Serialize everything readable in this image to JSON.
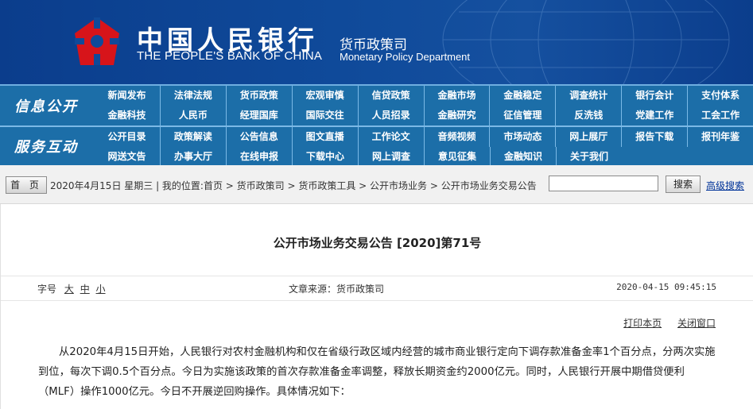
{
  "header": {
    "brand_cn": "中国人民银行",
    "brand_en": "THE PEOPLE'S BANK OF CHINA",
    "dept_cn": "货币政策司",
    "dept_en": "Monetary Policy Department"
  },
  "nav": {
    "info_title": "信息公开",
    "service_title": "服务互动",
    "info_row1": [
      "新闻发布",
      "法律法规",
      "货币政策",
      "宏观审慎",
      "信贷政策",
      "金融市场",
      "金融稳定",
      "调查统计",
      "银行会计",
      "支付体系"
    ],
    "info_row2": [
      "金融科技",
      "人民币",
      "经理国库",
      "国际交往",
      "人员招录",
      "金融研究",
      "征信管理",
      "反洗钱",
      "党建工作",
      "工会工作"
    ],
    "service_row1": [
      "公开目录",
      "政策解读",
      "公告信息",
      "图文直播",
      "工作论文",
      "音频视频",
      "市场动态",
      "网上展厅",
      "报告下载",
      "报刊年鉴"
    ],
    "service_row2": [
      "网送文告",
      "办事大厅",
      "在线申报",
      "下载中心",
      "网上调查",
      "意见征集",
      "金融知识",
      "关于我们"
    ]
  },
  "breadcrumb": {
    "home": "首 页",
    "text": "2020年4月15日 星期三 | 我的位置:首页 > 货币政策司 > 货币政策工具 > 公开市场业务 > 公开市场业务交易公告",
    "search_button": "搜索",
    "advanced_search": "高级搜索"
  },
  "article": {
    "title": "公开市场业务交易公告 [2020]第71号",
    "font_size_label": "字号",
    "font_size_options": [
      "大",
      "中",
      "小"
    ],
    "source": "文章来源：货币政策司",
    "date": "2020-04-15  09:45:15",
    "print_label": "打印本页",
    "close_label": "关闭窗口",
    "body": "从2020年4月15日开始，人民银行对农村金融机构和仅在省级行政区域内经营的城市商业银行定向下调存款准备金率1个百分点，分两次实施到位，每次下调0.5个百分点。今日为实施该政策的首次存款准备金率调整，释放长期资金约2000亿元。同时，人民银行开展中期借贷便利（MLF）操作1000亿元。今日不开展逆回购操作。具体情况如下："
  },
  "colors": {
    "banner": "#0f4a9a",
    "nav": "#1c6ea8",
    "logo_red": "#d7141a",
    "link": "#003399"
  }
}
